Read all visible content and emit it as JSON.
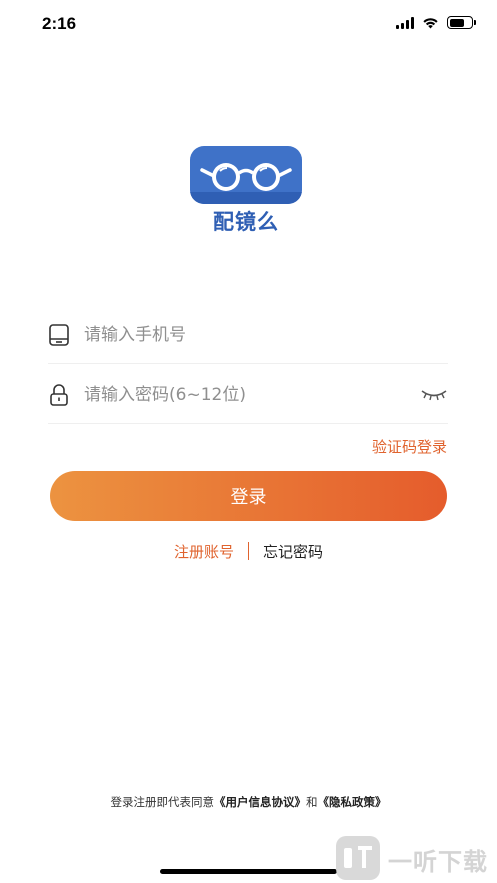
{
  "status_bar": {
    "time": "2:16"
  },
  "app": {
    "logo_text": "配镜么"
  },
  "form": {
    "phone_placeholder": "请输入手机号",
    "password_placeholder": "请输入密码(6~12位)",
    "sms_login_label": "验证码登录",
    "login_label": "登录",
    "register_label": "注册账号",
    "forgot_label": "忘记密码"
  },
  "agreement": {
    "prefix": "登录注册即代表同意",
    "user_agreement": "《用户信息协议》",
    "conjunction": "和",
    "privacy_policy": "《隐私政策》"
  },
  "watermark": {
    "text": "一听下载"
  },
  "colors": {
    "accent": "#e0632e",
    "button_gradient_start": "#ec9340",
    "button_gradient_end": "#e55c2c",
    "logo_blue": "#3f72c8"
  },
  "icons": {
    "phone": "phone-icon",
    "lock": "lock-icon",
    "eye_closed": "eye-closed-icon"
  }
}
